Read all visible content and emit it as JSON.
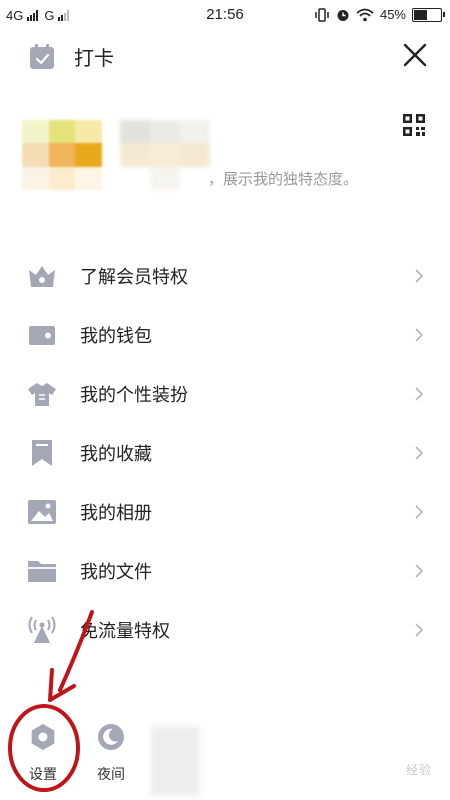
{
  "status_bar": {
    "carrier1": "4G",
    "carrier2": "G",
    "time": "21:56",
    "battery": "45%",
    "battery_level": 0.45
  },
  "header": {
    "checkin_label": "打卡"
  },
  "profile": {
    "signature": "，展示我的独特态度。"
  },
  "menu": {
    "items": [
      {
        "label": "了解会员特权",
        "icon": "crown-icon"
      },
      {
        "label": "我的钱包",
        "icon": "wallet-icon"
      },
      {
        "label": "我的个性装扮",
        "icon": "shirt-icon"
      },
      {
        "label": "我的收藏",
        "icon": "bookmark-icon"
      },
      {
        "label": "我的相册",
        "icon": "photo-icon"
      },
      {
        "label": "我的文件",
        "icon": "folder-icon"
      },
      {
        "label": "免流量特权",
        "icon": "signal-tower-icon"
      }
    ]
  },
  "bottom_bar": {
    "settings_label": "设置",
    "night_label": "夜间"
  },
  "watermark": "经验",
  "colors": {
    "icon_gray": "#a4a7b6",
    "annotation_red": "#c0141b",
    "text": "#222222",
    "subtext": "#9a9a9a"
  }
}
